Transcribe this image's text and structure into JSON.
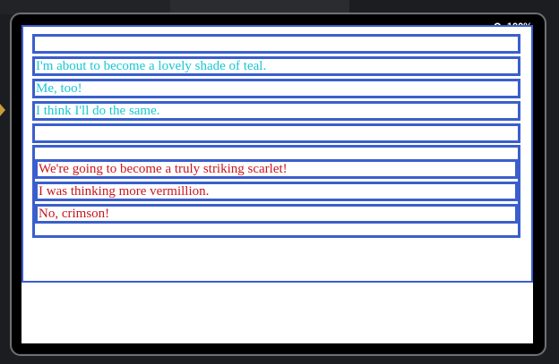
{
  "zoom": {
    "label": "100%",
    "icon": "magnifier-icon"
  },
  "colors": {
    "teal": "#19c7d6",
    "red": "#c8171d",
    "border": "#3a5fcd"
  },
  "teal_items": [
    "I'm about to become a lovely shade of teal.",
    "Me, too!",
    "I think I'll do the same."
  ],
  "red_items": [
    "We're going to become a truly striking scarlet!",
    "I was thinking more vermillion.",
    "No, crimson!"
  ]
}
